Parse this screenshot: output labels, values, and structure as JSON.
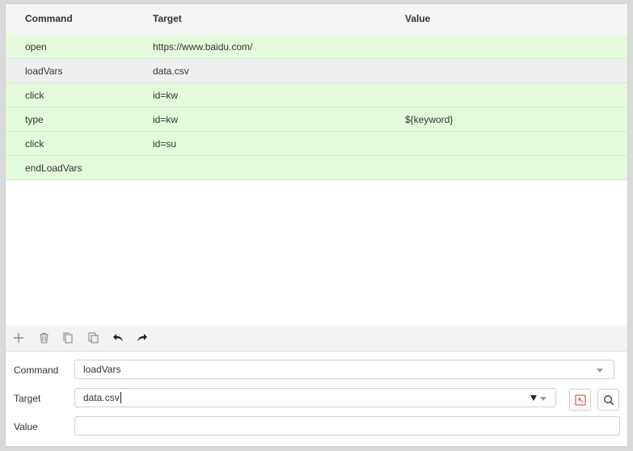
{
  "table": {
    "headers": {
      "command": "Command",
      "target": "Target",
      "value": "Value"
    },
    "rows": [
      {
        "command": "open",
        "target": "https://www.baidu.com/",
        "value": ""
      },
      {
        "command": "loadVars",
        "target": "data.csv",
        "value": ""
      },
      {
        "command": "click",
        "target": "id=kw",
        "value": ""
      },
      {
        "command": "type",
        "target": "id=kw",
        "value": "${keyword}"
      },
      {
        "command": "click",
        "target": "id=su",
        "value": ""
      },
      {
        "command": "endLoadVars",
        "target": "",
        "value": ""
      }
    ],
    "selected_row_index": 1
  },
  "toolbar": {
    "icons": [
      "plus-icon",
      "trash-icon",
      "copy-icon",
      "paste-icon",
      "undo-icon",
      "redo-icon"
    ]
  },
  "editor": {
    "command_label": "Command",
    "command_value": "loadVars",
    "target_label": "Target",
    "target_value": "data.csv",
    "value_label": "Value",
    "value_value": ""
  },
  "colors": {
    "row_bg": "#e3fbdb",
    "selected_row_bg": "#efefef",
    "select_target_icon": "#e05a5a"
  }
}
